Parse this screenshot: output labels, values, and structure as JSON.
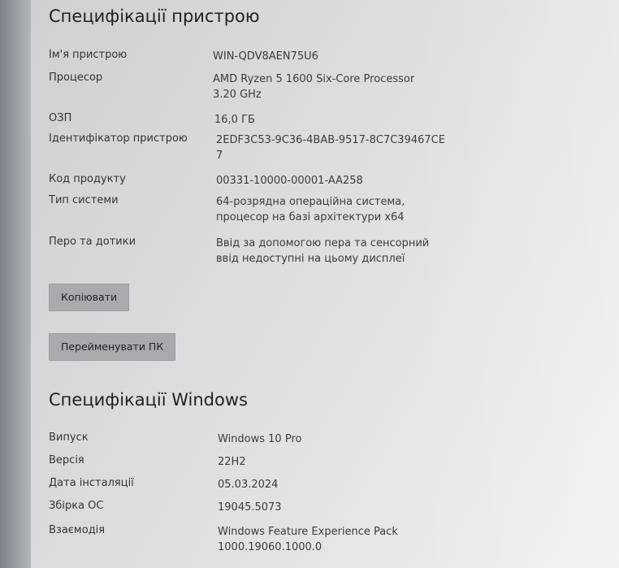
{
  "device_specs": {
    "title": "Специфікації пристрою",
    "rows": [
      {
        "label": "Ім'я пристрою",
        "value": [
          "WIN-QDV8AEN75U6"
        ]
      },
      {
        "label": "Процесор",
        "value": [
          "AMD Ryzen 5 1600 Six-Core Processor",
          "3.20 GHz"
        ]
      },
      {
        "label": "ОЗП",
        "value": [
          "16,0 ГБ"
        ]
      },
      {
        "label": "Ідентифікатор пристрою",
        "value": [
          "2EDF3C53-9C36-4BAB-9517-8C7C39467CE",
          "7"
        ]
      },
      {
        "label": "Код продукту",
        "value": [
          "00331-10000-00001-AA258"
        ]
      },
      {
        "label": "Тип системи",
        "value": [
          "64-розрядна операційна система,",
          "процесор на базі архітектури x64"
        ]
      },
      {
        "label": "Перо та дотики",
        "value": [
          "Ввід за допомогою пера та сенсорний",
          "ввід недоступні на цьому дисплеї"
        ]
      }
    ],
    "copy_button": "Копіювати",
    "rename_button": "Перейменувати ПК"
  },
  "windows_specs": {
    "title": "Специфікації Windows",
    "rows": [
      {
        "label": "Випуск",
        "value": [
          "Windows 10 Pro"
        ]
      },
      {
        "label": "Версія",
        "value": [
          "22H2"
        ]
      },
      {
        "label": "Дата інсталяції",
        "value": [
          "05.03.2024"
        ]
      },
      {
        "label": "Збірка ОС",
        "value": [
          "19045.5073"
        ]
      },
      {
        "label": "Взаємодія",
        "value": [
          "Windows Feature Experience Pack",
          "1000.19060.1000.0"
        ]
      }
    ]
  }
}
